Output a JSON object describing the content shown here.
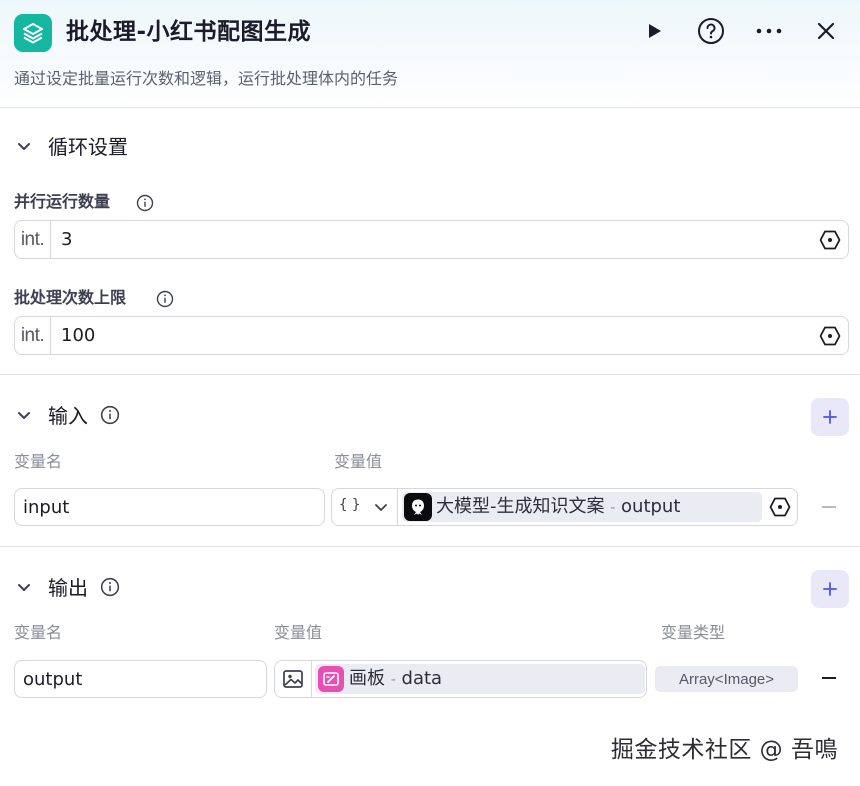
{
  "header": {
    "title": "批处理-小红书配图生成",
    "description": "通过设定批量运行次数和逻辑，运行批处理体内的任务"
  },
  "loop_settings": {
    "section_title": "循环设置",
    "parallel_label": "并行运行数量",
    "parallel_type": "int.",
    "parallel_value": "3",
    "limit_label": "批处理次数上限",
    "limit_type": "int.",
    "limit_value": "100"
  },
  "input_section": {
    "section_title": "输入",
    "col_name": "变量名",
    "col_value": "变量值",
    "rows": [
      {
        "name": "input",
        "type_icon": "{ }",
        "ref_node": "大模型-生成知识文案",
        "sep": "-",
        "ref_field": "output"
      }
    ]
  },
  "output_section": {
    "section_title": "输出",
    "col_name": "变量名",
    "col_value": "变量值",
    "col_type": "变量类型",
    "rows": [
      {
        "name": "output",
        "ref_node": "画板",
        "sep": "-",
        "ref_field": "data",
        "type": "Array<Image>"
      }
    ]
  },
  "watermark": "掘金技术社区 @ 吾鳴",
  "colors": {
    "accent_teal": "#14b8a0",
    "plus_bg": "#e8e8f8",
    "plus_fg": "#4d53e8",
    "chip_bg": "#ebebf3",
    "canvas_icon": "#e84fb5"
  }
}
